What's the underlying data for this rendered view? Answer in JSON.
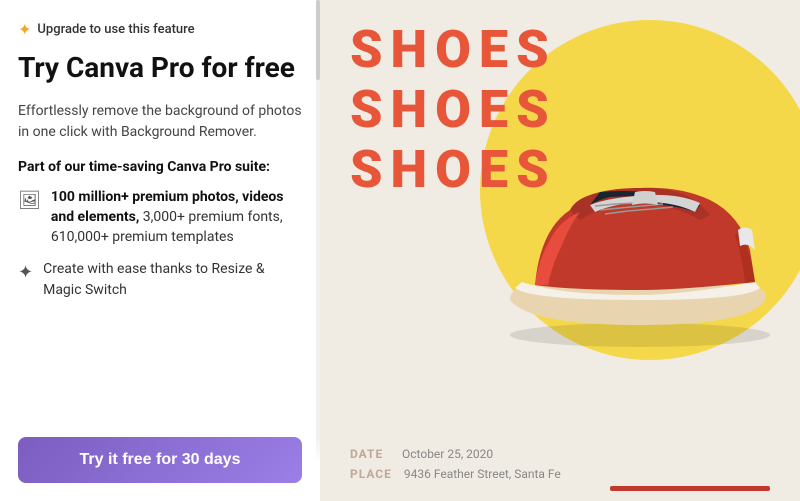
{
  "left": {
    "upgrade_badge": {
      "star": "✦",
      "text": "Upgrade to use this feature"
    },
    "headline": "Try Canva Pro for free",
    "description": "Effortlessly remove the background of photos in one click with Background Remover.",
    "suite_label": "Part of our time-saving Canva Pro suite:",
    "features": [
      {
        "icon": "🖼",
        "text_bold": "100 million+ premium photos, videos and elements,",
        "text_normal": " 3,000+ premium fonts, 610,000+ premium templates"
      },
      {
        "icon": "✦",
        "text_bold": "",
        "text_normal": "Create with ease thanks to Resize & Magic Switch"
      }
    ],
    "cta_button": "Try it free for 30 days"
  },
  "right": {
    "shoes_lines": [
      "SHOES",
      "SHOES",
      "SHOES"
    ],
    "bottom_info": [
      {
        "label": "DATE",
        "value": "October 25, 2020"
      },
      {
        "label": "PLACE",
        "value": "9436 Feather Street, Santa Fe"
      }
    ]
  }
}
